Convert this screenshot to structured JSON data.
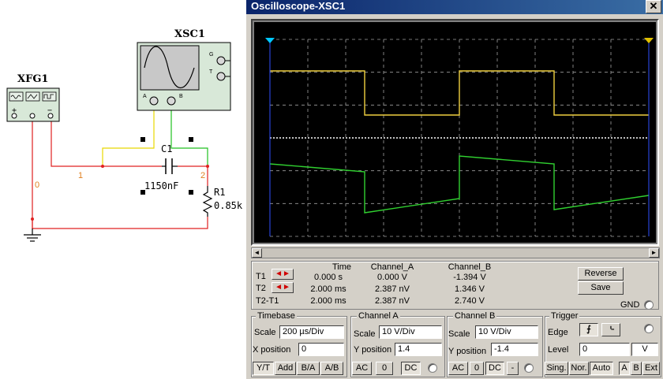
{
  "schematic": {
    "fg_label": "XFG1",
    "scope_label": "XSC1",
    "cap_label": "C1",
    "cap_value": "1150nF",
    "res_label": "R1",
    "res_value": "0.85k",
    "node_0": "0",
    "node_1": "1",
    "node_2": "2",
    "scope_term_a": "A",
    "scope_term_b": "B",
    "scope_term_g": "G",
    "scope_term_t": "T",
    "fg_plus": "+",
    "fg_minus": "−"
  },
  "window": {
    "title": "Oscilloscope-XSC1",
    "close_label": "✕"
  },
  "scroll": {
    "left_label": "◄",
    "right_label": "►"
  },
  "readout": {
    "headers": [
      "Time",
      "Channel_A",
      "Channel_B"
    ],
    "rows": [
      {
        "label": "T1",
        "time": "0.000 s",
        "cha": "0.000 V",
        "chb": "-1.394 V"
      },
      {
        "label": "T2",
        "time": "2.000 ms",
        "cha": "2.387 nV",
        "chb": "1.346 V"
      },
      {
        "label": "T2-T1",
        "time": "2.000 ms",
        "cha": "2.387 nV",
        "chb": "2.740 V"
      }
    ],
    "reverse_label": "Reverse",
    "save_label": "Save",
    "gnd_label": "GND",
    "arrow_glyph": "◄►"
  },
  "timebase": {
    "title": "Timebase",
    "scale_label": "Scale",
    "scale_value": "200 µs/Div",
    "xpos_label": "X position",
    "xpos_value": "0",
    "modes": [
      "Y/T",
      "Add",
      "B/A",
      "A/B"
    ]
  },
  "channel_a": {
    "title": "Channel A",
    "scale_label": "Scale",
    "scale_value": "10  V/Div",
    "ypos_label": "Y position",
    "ypos_value": "1.4",
    "coupling": [
      "AC",
      "0",
      "DC"
    ]
  },
  "channel_b": {
    "title": "Channel B",
    "scale_label": "Scale",
    "scale_value": "10  V/Div",
    "ypos_label": "Y position",
    "ypos_value": "-1.4",
    "coupling": [
      "AC",
      "0",
      "DC",
      "-"
    ]
  },
  "trigger": {
    "title": "Trigger",
    "edge_label": "Edge",
    "level_label": "Level",
    "level_value": "0",
    "level_unit": "V",
    "edge_rise": "⨍",
    "edge_fall": "⌎",
    "modes": [
      "Sing.",
      "Nor.",
      "Auto"
    ],
    "sources": [
      "A",
      "B",
      "Ext"
    ]
  },
  "colors": {
    "trace_a": "#f0d040",
    "trace_b": "#30d030",
    "wire_red": "#e02020",
    "wire_yellow": "#e8d800",
    "wire_green": "#20c020",
    "screen_bg": "#000000",
    "cursor_t1": "#00c8ff",
    "cursor_t2": "#e0c000"
  }
}
